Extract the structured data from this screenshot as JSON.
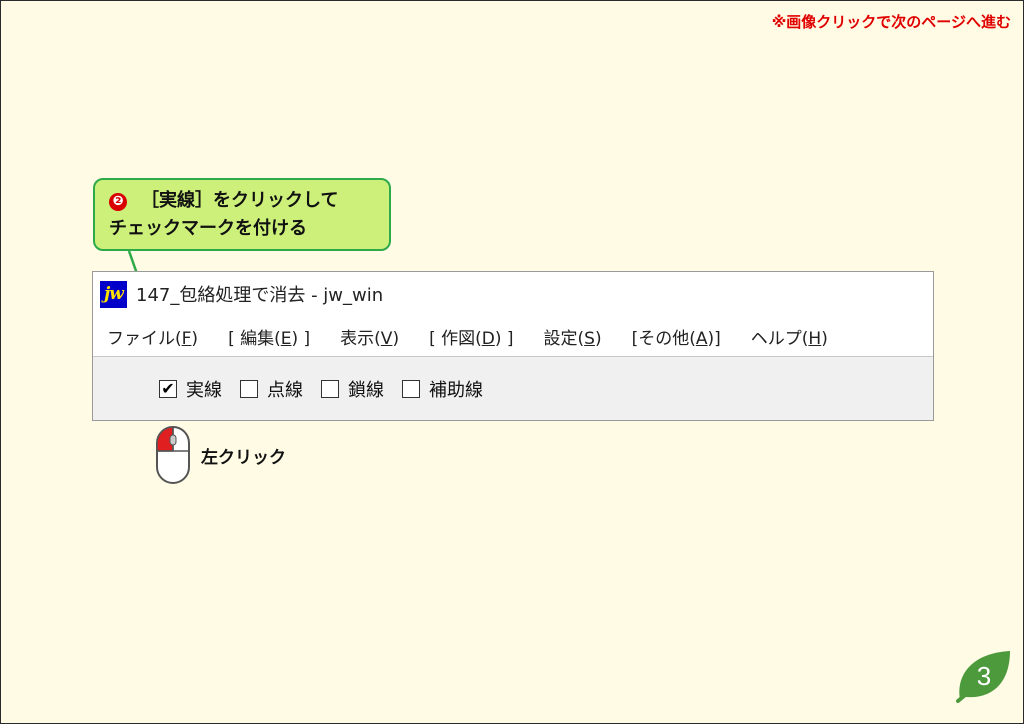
{
  "header_note": "※画像クリックで次のページへ進む",
  "callout": {
    "step_number": "❷",
    "line1": "［実線］をクリックして",
    "line2": "チェックマークを付ける"
  },
  "window": {
    "app_icon_text": "jw",
    "title": "147_包絡処理で消去 - jw_win",
    "menu": [
      {
        "label": "ファイル(",
        "key": "F",
        "end": ")"
      },
      {
        "label": "[ 編集(",
        "key": "E",
        "end": ") ]"
      },
      {
        "label": "表示(",
        "key": "V",
        "end": ")"
      },
      {
        "label": "[ 作図(",
        "key": "D",
        "end": ") ]"
      },
      {
        "label": "設定(",
        "key": "S",
        "end": ")"
      },
      {
        "label": "[その他(",
        "key": "A",
        "end": ")]"
      },
      {
        "label": "ヘルプ(",
        "key": "H",
        "end": ")"
      }
    ],
    "toolbar": [
      {
        "label": "実線",
        "checked": true,
        "mark": "✔"
      },
      {
        "label": "点線",
        "checked": false,
        "mark": ""
      },
      {
        "label": "鎖線",
        "checked": false,
        "mark": ""
      },
      {
        "label": "補助線",
        "checked": false,
        "mark": ""
      }
    ]
  },
  "mouse_hint": {
    "label": "左クリック",
    "icon": "mouse-left-click-icon"
  },
  "page_number": "3",
  "colors": {
    "background": "#fffbe5",
    "note_red": "#e00000",
    "callout_fill": "#ccf07a",
    "callout_border": "#2faa4b",
    "leaf_green": "#4c9a3c"
  }
}
